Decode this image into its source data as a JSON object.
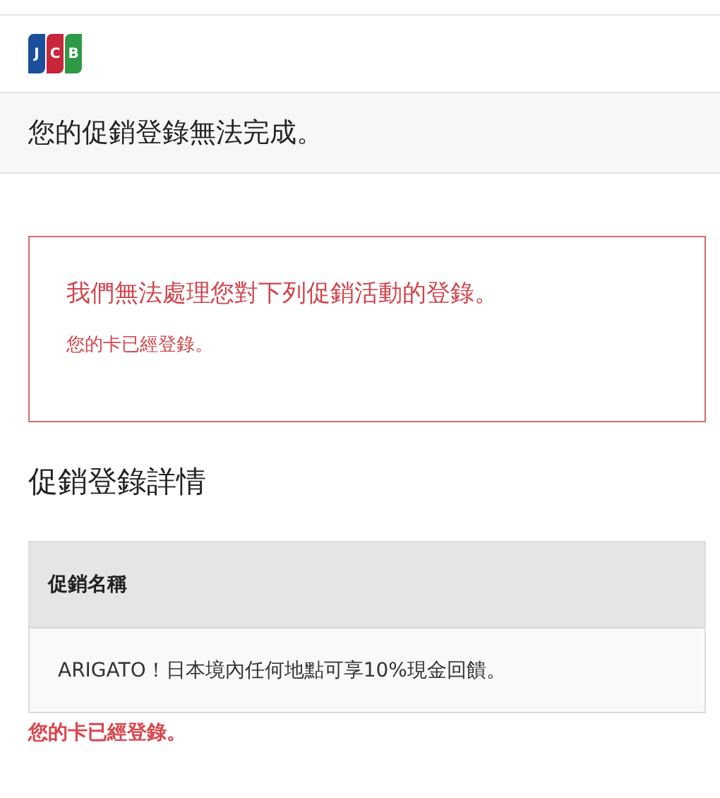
{
  "logo": {
    "letters": [
      "J",
      "C",
      "B"
    ]
  },
  "page_title": "您的促銷登錄無法完成。",
  "error_box": {
    "heading": "我們無法處理您對下列促銷活動的登錄。",
    "message": "您的卡已經登錄。"
  },
  "section_title": "促銷登錄詳情",
  "table": {
    "columns": [
      "促銷名稱"
    ],
    "rows": [
      [
        "ARIGATO！日本境內任何地點可享10%現金回饋。"
      ]
    ]
  },
  "row_error": "您的卡已經登錄。"
}
